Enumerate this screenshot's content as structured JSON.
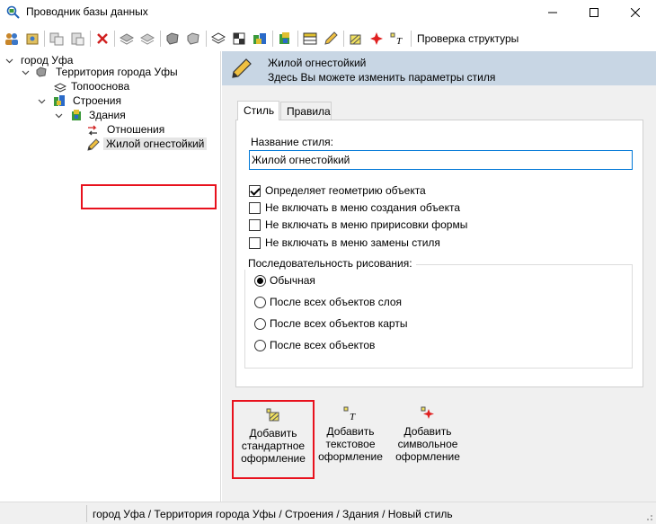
{
  "window": {
    "title": "Проводник базы данных",
    "icon": "database-explorer-icon",
    "minimize_icon": "minimize-icon",
    "maximize_icon": "maximize-icon",
    "close_icon": "close-icon"
  },
  "toolbar": {
    "check_structure_label": "Проверка структуры"
  },
  "tree": {
    "items": [
      {
        "label": "город Уфа",
        "icon": "city-icon",
        "expanded": true
      },
      {
        "label": "Территория города Уфы",
        "icon": "territory-icon",
        "expanded": true
      },
      {
        "label": "Топооснова",
        "icon": "layers-icon",
        "expanded": false
      },
      {
        "label": "Строения",
        "icon": "buildings-layer-icon",
        "expanded": true
      },
      {
        "label": "Здания",
        "icon": "buildings-icon",
        "expanded": true
      },
      {
        "label": "Отношения",
        "icon": "relations-icon",
        "expanded": false
      },
      {
        "label": "Жилой огнестойкий",
        "icon": "pencil-icon",
        "selected": true
      }
    ]
  },
  "header": {
    "title": "Жилой огнестойкий",
    "subtitle": "Здесь Вы можете изменить параметры стиля"
  },
  "tabs": [
    {
      "label": "Стиль",
      "active": true
    },
    {
      "label": "Правила",
      "active": false
    }
  ],
  "style_tab": {
    "name_label": "Название стиля:",
    "name_value": "Жилой огнестойкий",
    "checkboxes": [
      {
        "label": "Определяет геометрию объекта",
        "checked": true
      },
      {
        "label": "Не включать в меню создания объекта",
        "checked": false
      },
      {
        "label": "Не включать в меню пририсовки формы",
        "checked": false
      },
      {
        "label": "Не включать в меню замены стиля",
        "checked": false
      }
    ],
    "draw_order_title": "Последовательность рисования:",
    "draw_order_options": [
      {
        "label": "Обычная",
        "selected": true
      },
      {
        "label": "После всех объектов слоя",
        "selected": false
      },
      {
        "label": "После всех объектов карты",
        "selected": false
      },
      {
        "label": "После всех объектов",
        "selected": false
      }
    ]
  },
  "add_buttons": [
    {
      "label": "Добавить стандартное оформление",
      "line1": "Добавить",
      "line2": "стандартное",
      "line3": "оформление"
    },
    {
      "label": "Добавить текстовое оформление",
      "line1": "Добавить",
      "line2": "текстовое",
      "line3": "оформление"
    },
    {
      "label": "Добавить символьное оформление",
      "line1": "Добавить",
      "line2": "символьное",
      "line3": "оформление"
    }
  ],
  "statusbar": {
    "path": "город Уфа / Территория города Уфы / Строения / Здания / Новый стиль"
  },
  "colors": {
    "header_bg": "#c8d6e4",
    "highlight_red": "#e8111d",
    "focus_blue": "#0078d7"
  }
}
